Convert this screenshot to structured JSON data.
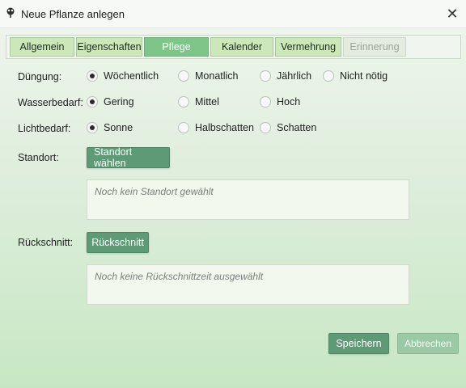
{
  "window": {
    "title": "Neue Pflanze anlegen",
    "close_glyph": "✕",
    "icon": "plant-icon"
  },
  "tabs": [
    {
      "label": "Allgemein",
      "state": "normal"
    },
    {
      "label": "Eigenschaften",
      "state": "normal"
    },
    {
      "label": "Pflege",
      "state": "active"
    },
    {
      "label": "Kalender",
      "state": "normal"
    },
    {
      "label": "Vermehrung",
      "state": "normal"
    },
    {
      "label": "Erinnerung",
      "state": "disabled"
    }
  ],
  "duengung": {
    "label": "Düngung:",
    "options": [
      "Wöchentlich",
      "Monatlich",
      "Jährlich",
      "Nicht nötig"
    ],
    "selected": "Wöchentlich"
  },
  "wasserbedarf": {
    "label": "Wasserbedarf:",
    "options": [
      "Gering",
      "Mittel",
      "Hoch"
    ],
    "selected": "Gering"
  },
  "lichtbedarf": {
    "label": "Lichtbedarf:",
    "options": [
      "Sonne",
      "Halbschatten",
      "Schatten"
    ],
    "selected": "Sonne"
  },
  "standort": {
    "label": "Standort:",
    "button": "Standort wählen",
    "placeholder": "Noch kein Standort gewählt"
  },
  "rueckschnitt": {
    "label": "Rückschnitt:",
    "button": "Rückschnitt",
    "placeholder": "Noch keine Rückschnittzeit ausgewählt"
  },
  "footer": {
    "save": "Speichern",
    "cancel": "Abbrechen"
  },
  "colors": {
    "accent": "#5f9a76",
    "tab_active": "#7ec58a",
    "tab_normal": "#cce7b9"
  }
}
